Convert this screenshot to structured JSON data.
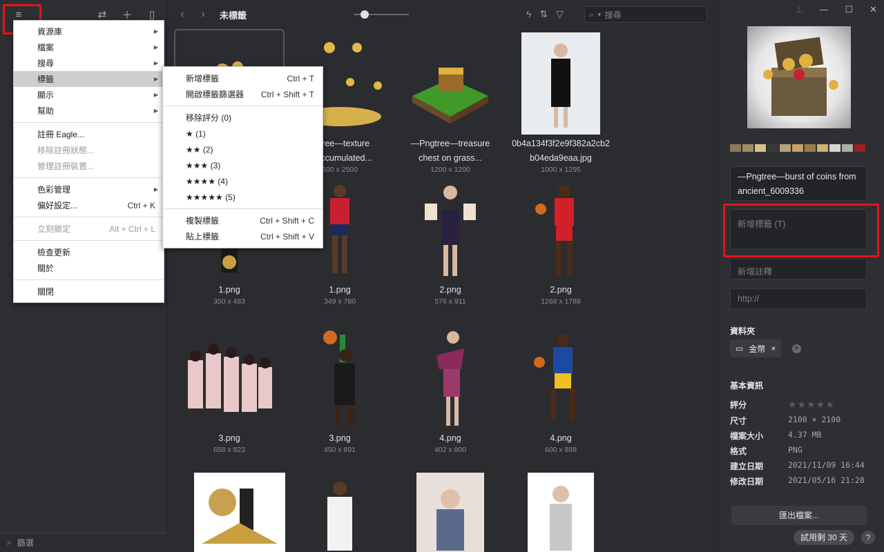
{
  "sidebar": {
    "filter_label": "篩選"
  },
  "topbar": {
    "title": "未標籤",
    "search_placeholder": "搜尋"
  },
  "main_menu": {
    "items": [
      {
        "label": "資源庫",
        "shortcut": "",
        "submenu": true,
        "disabled": false
      },
      {
        "label": "檔案",
        "shortcut": "",
        "submenu": true,
        "disabled": false
      },
      {
        "label": "搜尋",
        "shortcut": "",
        "submenu": true,
        "disabled": false
      },
      {
        "label": "標籤",
        "shortcut": "",
        "submenu": true,
        "disabled": false,
        "selected": true
      },
      {
        "label": "顯示",
        "shortcut": "",
        "submenu": true,
        "disabled": false
      },
      {
        "label": "幫助",
        "shortcut": "",
        "submenu": true,
        "disabled": false
      },
      {
        "label": "註冊 Eagle...",
        "shortcut": "",
        "submenu": false,
        "disabled": false
      },
      {
        "label": "移除註冊狀態...",
        "shortcut": "",
        "submenu": false,
        "disabled": true
      },
      {
        "label": "管理註冊裝置...",
        "shortcut": "",
        "submenu": false,
        "disabled": true
      },
      {
        "label": "色彩管理",
        "shortcut": "",
        "submenu": true,
        "disabled": false
      },
      {
        "label": "偏好設定...",
        "shortcut": "Ctrl + K",
        "submenu": false,
        "disabled": false
      },
      {
        "label": "立刻鎖定",
        "shortcut": "Alt + Ctrl + L",
        "submenu": false,
        "disabled": true
      },
      {
        "label": "檢查更新",
        "shortcut": "",
        "submenu": false,
        "disabled": false
      },
      {
        "label": "關於",
        "shortcut": "",
        "submenu": false,
        "disabled": false
      },
      {
        "label": "關閉",
        "shortcut": "",
        "submenu": false,
        "disabled": false
      }
    ]
  },
  "tag_submenu": {
    "items": [
      {
        "label": "新增標籤",
        "shortcut": "Ctrl + T"
      },
      {
        "label": "開啟標籤篩選器",
        "shortcut": "Ctrl + Shift + T"
      },
      {
        "label": "移除評分 (0)",
        "shortcut": ""
      },
      {
        "label": "★ (1)",
        "shortcut": ""
      },
      {
        "label": "★★ (2)",
        "shortcut": ""
      },
      {
        "label": "★★★ (3)",
        "shortcut": ""
      },
      {
        "label": "★★★★ (4)",
        "shortcut": ""
      },
      {
        "label": "★★★★★ (5)",
        "shortcut": ""
      },
      {
        "label": "複製標籤",
        "shortcut": "Ctrl + Shift + C"
      },
      {
        "label": "貼上標籤",
        "shortcut": "Ctrl + Shift + V"
      }
    ]
  },
  "grid": {
    "items": [
      {
        "name1": "",
        "name2": "",
        "dim": ""
      },
      {
        "name1": "ngtree—texture",
        "name2": "ls accumulated...",
        "dim": "500 x 2500"
      },
      {
        "name1": "—Pngtree—treasure",
        "name2": "chest on grass...",
        "dim": "1200 x 1200"
      },
      {
        "name1": "0b4a134f3f2e9f382a2cb2",
        "name2": "b04eda9eaa.jpg",
        "dim": "1000 x 1295"
      },
      {
        "name1": "1.png",
        "name2": "",
        "dim": "350 x 483"
      },
      {
        "name1": "1.png",
        "name2": "",
        "dim": "349 x 780"
      },
      {
        "name1": "2.png",
        "name2": "",
        "dim": "576 x 911"
      },
      {
        "name1": "2.png",
        "name2": "",
        "dim": "1268 x 1788"
      },
      {
        "name1": "3.png",
        "name2": "",
        "dim": "658 x 823"
      },
      {
        "name1": "3.png",
        "name2": "",
        "dim": "450 x 891"
      },
      {
        "name1": "4.png",
        "name2": "",
        "dim": "402 x 800"
      },
      {
        "name1": "4.png",
        "name2": "",
        "dim": "600 x 888"
      }
    ]
  },
  "inspector": {
    "filename": "—Pngtree—burst of coins from ancient_6009336",
    "tag_placeholder": "新增標籤 (T)",
    "note_placeholder": "新增註釋",
    "url_placeholder": "http://",
    "folder_section": "資料夾",
    "folder_name": "金幣",
    "basic_info": "基本資訊",
    "rows": [
      {
        "key": "評分",
        "value": "★★★★★"
      },
      {
        "key": "尺寸",
        "value": "2100 × 2100"
      },
      {
        "key": "檔案大小",
        "value": "4.37 MB"
      },
      {
        "key": "格式",
        "value": "PNG"
      },
      {
        "key": "建立日期",
        "value": "2021/11/09 16:44"
      },
      {
        "key": "修改日期",
        "value": "2021/05/16 21:28"
      }
    ],
    "export_label": "匯出檔案...",
    "trial_label": "試用剩 30 天",
    "help_label": "?",
    "palette": [
      "#8a7a5a",
      "#a08c62",
      "#d8c48a",
      "#3a3a3a",
      "#b8a27a",
      "#c8a060",
      "#9a7c4a",
      "#d0b070",
      "#d8d4d0",
      "#b0aca8",
      "#a02020"
    ]
  }
}
